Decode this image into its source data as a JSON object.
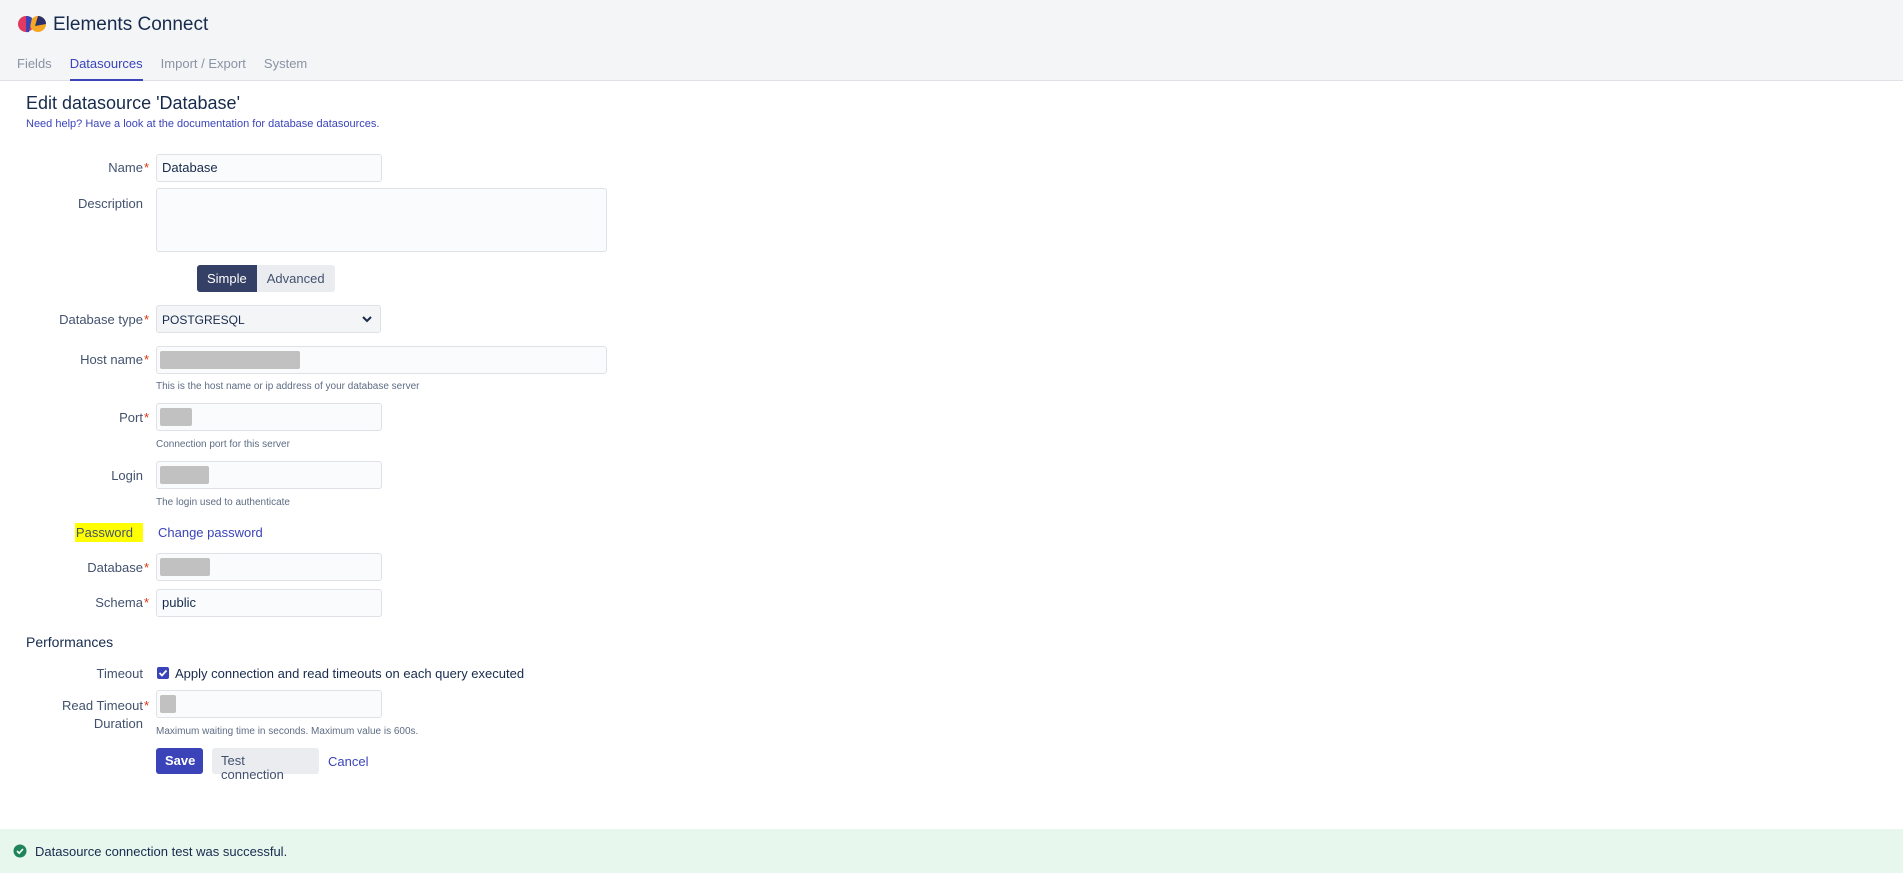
{
  "app": {
    "title": "Elements Connect"
  },
  "nav": {
    "tabs": [
      "Fields",
      "Datasources",
      "Import / Export",
      "System"
    ],
    "active": "Datasources"
  },
  "page": {
    "title": "Edit datasource 'Database'",
    "help": "Need help? Have a look at the documentation for database datasources."
  },
  "form": {
    "name_label": "Name",
    "name_value": "Database",
    "description_label": "Description",
    "description_value": "",
    "mode_simple": "Simple",
    "mode_advanced": "Advanced",
    "dbtype_label": "Database type",
    "dbtype_value": "POSTGRESQL",
    "host_label": "Host name",
    "host_hint": "This is the host name or ip address of your database server",
    "port_label": "Port",
    "port_hint": "Connection port for this server",
    "login_label": "Login",
    "login_hint": "The login used to authenticate",
    "password_label": "Password",
    "password_link": "Change password",
    "database_label": "Database",
    "schema_label": "Schema",
    "schema_value": "public",
    "required_mark": "*"
  },
  "performances": {
    "title": "Performances",
    "timeout_label": "Timeout",
    "timeout_checkbox": "Apply connection and read timeouts on each query executed",
    "timeout_checked": true,
    "read_timeout_label_1": "Read Timeout",
    "read_timeout_label_2": "Duration",
    "read_timeout_hint": "Maximum waiting time in seconds. Maximum value is 600s."
  },
  "actions": {
    "save": "Save",
    "test": "Test connection",
    "cancel": "Cancel"
  },
  "flag": {
    "message": "Datasource connection test was successful."
  },
  "colors": {
    "accent": "#3a44b8",
    "segment_active": "#354066",
    "success_bg": "#e8f7ee",
    "success_icon": "#1f845a",
    "highlight": "#ffff00"
  }
}
